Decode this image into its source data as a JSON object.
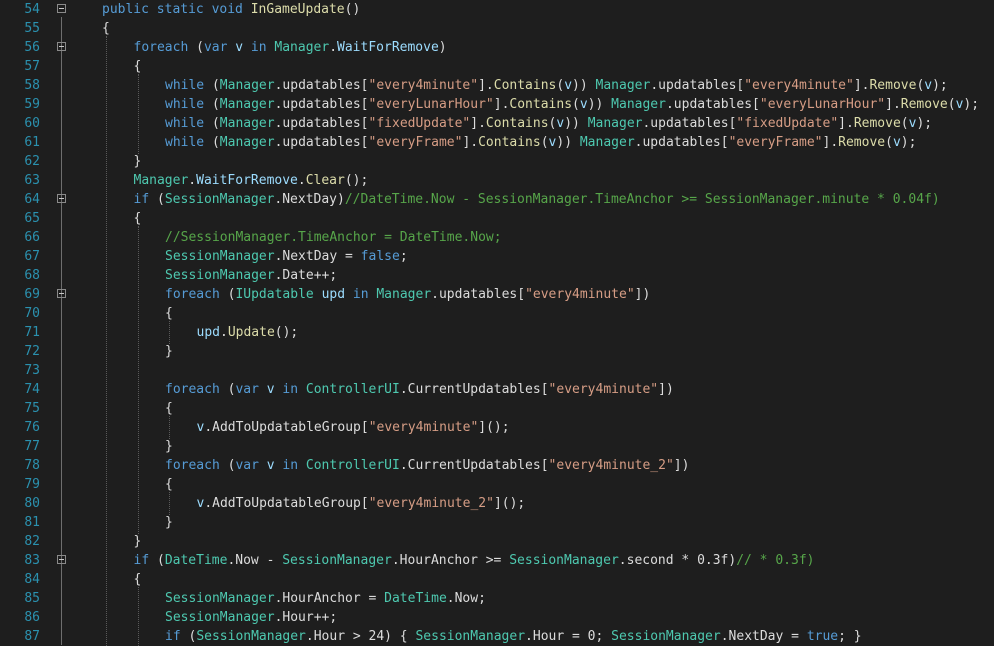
{
  "colors": {
    "background": "#1e1e1e",
    "line_number": "#2b91af",
    "keyword": "#569cd6",
    "type": "#4ec9b0",
    "method": "#dcdcaa",
    "string": "#d69d85",
    "comment": "#57a64a",
    "variable": "#9cdcfe",
    "plain": "#dcdcdc"
  },
  "fold_icon": "collapse-minus-icon",
  "lines": [
    {
      "n": "54",
      "indent": 0,
      "fold": true,
      "tokens": [
        [
          "kw",
          "public static void "
        ],
        [
          "mt",
          "InGameUpdate"
        ],
        [
          "pl",
          "()"
        ]
      ]
    },
    {
      "n": "55",
      "indent": 0,
      "fold": false,
      "tokens": [
        [
          "pl",
          "{"
        ]
      ]
    },
    {
      "n": "56",
      "indent": 1,
      "fold": true,
      "tokens": [
        [
          "kw",
          "foreach"
        ],
        [
          "pl",
          " ("
        ],
        [
          "kw",
          "var"
        ],
        [
          "pl",
          " "
        ],
        [
          "vr",
          "v"
        ],
        [
          "pl",
          " "
        ],
        [
          "kw",
          "in"
        ],
        [
          "pl",
          " "
        ],
        [
          "ty",
          "Manager"
        ],
        [
          "pl",
          "."
        ],
        [
          "vr",
          "WaitForRemove"
        ],
        [
          "pl",
          ")"
        ]
      ]
    },
    {
      "n": "57",
      "indent": 1,
      "fold": false,
      "tokens": [
        [
          "pl",
          "{"
        ]
      ]
    },
    {
      "n": "58",
      "indent": 2,
      "fold": false,
      "tokens": [
        [
          "kw",
          "while"
        ],
        [
          "pl",
          " ("
        ],
        [
          "ty",
          "Manager"
        ],
        [
          "pl",
          ".updatables["
        ],
        [
          "st",
          "\"every4minute\""
        ],
        [
          "pl",
          "]."
        ],
        [
          "mt",
          "Contains"
        ],
        [
          "pl",
          "("
        ],
        [
          "vr",
          "v"
        ],
        [
          "pl",
          ")) "
        ],
        [
          "ty",
          "Manager"
        ],
        [
          "pl",
          ".updatables["
        ],
        [
          "st",
          "\"every4minute\""
        ],
        [
          "pl",
          "]."
        ],
        [
          "mt",
          "Remove"
        ],
        [
          "pl",
          "("
        ],
        [
          "vr",
          "v"
        ],
        [
          "pl",
          ");"
        ]
      ]
    },
    {
      "n": "59",
      "indent": 2,
      "fold": false,
      "tokens": [
        [
          "kw",
          "while"
        ],
        [
          "pl",
          " ("
        ],
        [
          "ty",
          "Manager"
        ],
        [
          "pl",
          ".updatables["
        ],
        [
          "st",
          "\"everyLunarHour\""
        ],
        [
          "pl",
          "]."
        ],
        [
          "mt",
          "Contains"
        ],
        [
          "pl",
          "("
        ],
        [
          "vr",
          "v"
        ],
        [
          "pl",
          ")) "
        ],
        [
          "ty",
          "Manager"
        ],
        [
          "pl",
          ".updatables["
        ],
        [
          "st",
          "\"everyLunarHour\""
        ],
        [
          "pl",
          "]."
        ],
        [
          "mt",
          "Remove"
        ],
        [
          "pl",
          "("
        ],
        [
          "vr",
          "v"
        ],
        [
          "pl",
          ");"
        ]
      ]
    },
    {
      "n": "60",
      "indent": 2,
      "fold": false,
      "tokens": [
        [
          "kw",
          "while"
        ],
        [
          "pl",
          " ("
        ],
        [
          "ty",
          "Manager"
        ],
        [
          "pl",
          ".updatables["
        ],
        [
          "st",
          "\"fixedUpdate\""
        ],
        [
          "pl",
          "]."
        ],
        [
          "mt",
          "Contains"
        ],
        [
          "pl",
          "("
        ],
        [
          "vr",
          "v"
        ],
        [
          "pl",
          ")) "
        ],
        [
          "ty",
          "Manager"
        ],
        [
          "pl",
          ".updatables["
        ],
        [
          "st",
          "\"fixedUpdate\""
        ],
        [
          "pl",
          "]."
        ],
        [
          "mt",
          "Remove"
        ],
        [
          "pl",
          "("
        ],
        [
          "vr",
          "v"
        ],
        [
          "pl",
          ");"
        ]
      ]
    },
    {
      "n": "61",
      "indent": 2,
      "fold": false,
      "tokens": [
        [
          "kw",
          "while"
        ],
        [
          "pl",
          " ("
        ],
        [
          "ty",
          "Manager"
        ],
        [
          "pl",
          ".updatables["
        ],
        [
          "st",
          "\"everyFrame\""
        ],
        [
          "pl",
          "]."
        ],
        [
          "mt",
          "Contains"
        ],
        [
          "pl",
          "("
        ],
        [
          "vr",
          "v"
        ],
        [
          "pl",
          ")) "
        ],
        [
          "ty",
          "Manager"
        ],
        [
          "pl",
          ".updatables["
        ],
        [
          "st",
          "\"everyFrame\""
        ],
        [
          "pl",
          "]."
        ],
        [
          "mt",
          "Remove"
        ],
        [
          "pl",
          "("
        ],
        [
          "vr",
          "v"
        ],
        [
          "pl",
          ");"
        ]
      ]
    },
    {
      "n": "62",
      "indent": 1,
      "fold": false,
      "tokens": [
        [
          "pl",
          "}"
        ]
      ]
    },
    {
      "n": "63",
      "indent": 1,
      "fold": false,
      "tokens": [
        [
          "ty",
          "Manager"
        ],
        [
          "pl",
          "."
        ],
        [
          "vr",
          "WaitForRemove"
        ],
        [
          "pl",
          "."
        ],
        [
          "mt",
          "Clear"
        ],
        [
          "pl",
          "();"
        ]
      ]
    },
    {
      "n": "64",
      "indent": 1,
      "fold": true,
      "tokens": [
        [
          "kw",
          "if"
        ],
        [
          "pl",
          " ("
        ],
        [
          "ty",
          "SessionManager"
        ],
        [
          "pl",
          ".NextDay)"
        ],
        [
          "cm",
          "//DateTime.Now - SessionManager.TimeAnchor >= SessionManager.minute * 0.04f)"
        ]
      ]
    },
    {
      "n": "65",
      "indent": 1,
      "fold": false,
      "tokens": [
        [
          "pl",
          "{"
        ]
      ]
    },
    {
      "n": "66",
      "indent": 2,
      "fold": false,
      "tokens": [
        [
          "cm",
          "//SessionManager.TimeAnchor = DateTime.Now;"
        ]
      ]
    },
    {
      "n": "67",
      "indent": 2,
      "fold": false,
      "tokens": [
        [
          "ty",
          "SessionManager"
        ],
        [
          "pl",
          ".NextDay = "
        ],
        [
          "kw",
          "false"
        ],
        [
          "pl",
          ";"
        ]
      ]
    },
    {
      "n": "68",
      "indent": 2,
      "fold": false,
      "tokens": [
        [
          "ty",
          "SessionManager"
        ],
        [
          "pl",
          ".Date++;"
        ]
      ]
    },
    {
      "n": "69",
      "indent": 2,
      "fold": true,
      "tokens": [
        [
          "kw",
          "foreach"
        ],
        [
          "pl",
          " ("
        ],
        [
          "ty",
          "IUpdatable"
        ],
        [
          "pl",
          " "
        ],
        [
          "vr",
          "upd"
        ],
        [
          "pl",
          " "
        ],
        [
          "kw",
          "in"
        ],
        [
          "pl",
          " "
        ],
        [
          "ty",
          "Manager"
        ],
        [
          "pl",
          ".updatables["
        ],
        [
          "st",
          "\"every4minute\""
        ],
        [
          "pl",
          "])"
        ]
      ]
    },
    {
      "n": "70",
      "indent": 2,
      "fold": false,
      "tokens": [
        [
          "pl",
          "{"
        ]
      ]
    },
    {
      "n": "71",
      "indent": 3,
      "fold": false,
      "tokens": [
        [
          "vr",
          "upd"
        ],
        [
          "pl",
          "."
        ],
        [
          "mt",
          "Update"
        ],
        [
          "pl",
          "();"
        ]
      ]
    },
    {
      "n": "72",
      "indent": 2,
      "fold": false,
      "tokens": [
        [
          "pl",
          "}"
        ]
      ]
    },
    {
      "n": "73",
      "indent": 2,
      "fold": false,
      "tokens": []
    },
    {
      "n": "74",
      "indent": 2,
      "fold": false,
      "tokens": [
        [
          "kw",
          "foreach"
        ],
        [
          "pl",
          " ("
        ],
        [
          "kw",
          "var"
        ],
        [
          "pl",
          " "
        ],
        [
          "vr",
          "v"
        ],
        [
          "pl",
          " "
        ],
        [
          "kw",
          "in"
        ],
        [
          "pl",
          " "
        ],
        [
          "ty",
          "ControllerUI"
        ],
        [
          "pl",
          ".CurrentUpdatables["
        ],
        [
          "st",
          "\"every4minute\""
        ],
        [
          "pl",
          "])"
        ]
      ]
    },
    {
      "n": "75",
      "indent": 2,
      "fold": false,
      "tokens": [
        [
          "pl",
          "{"
        ]
      ]
    },
    {
      "n": "76",
      "indent": 3,
      "fold": false,
      "tokens": [
        [
          "vr",
          "v"
        ],
        [
          "pl",
          ".AddToUpdatableGroup["
        ],
        [
          "st",
          "\"every4minute\""
        ],
        [
          "pl",
          "]();"
        ]
      ]
    },
    {
      "n": "77",
      "indent": 2,
      "fold": false,
      "tokens": [
        [
          "pl",
          "}"
        ]
      ]
    },
    {
      "n": "78",
      "indent": 2,
      "fold": false,
      "tokens": [
        [
          "kw",
          "foreach"
        ],
        [
          "pl",
          " ("
        ],
        [
          "kw",
          "var"
        ],
        [
          "pl",
          " "
        ],
        [
          "vr",
          "v"
        ],
        [
          "pl",
          " "
        ],
        [
          "kw",
          "in"
        ],
        [
          "pl",
          " "
        ],
        [
          "ty",
          "ControllerUI"
        ],
        [
          "pl",
          ".CurrentUpdatables["
        ],
        [
          "st",
          "\"every4minute_2\""
        ],
        [
          "pl",
          "])"
        ]
      ]
    },
    {
      "n": "79",
      "indent": 2,
      "fold": false,
      "tokens": [
        [
          "pl",
          "{"
        ]
      ]
    },
    {
      "n": "80",
      "indent": 3,
      "fold": false,
      "tokens": [
        [
          "vr",
          "v"
        ],
        [
          "pl",
          ".AddToUpdatableGroup["
        ],
        [
          "st",
          "\"every4minute_2\""
        ],
        [
          "pl",
          "]();"
        ]
      ]
    },
    {
      "n": "81",
      "indent": 2,
      "fold": false,
      "tokens": [
        [
          "pl",
          "}"
        ]
      ]
    },
    {
      "n": "82",
      "indent": 1,
      "fold": false,
      "tokens": [
        [
          "pl",
          "}"
        ]
      ]
    },
    {
      "n": "83",
      "indent": 1,
      "fold": true,
      "tokens": [
        [
          "kw",
          "if"
        ],
        [
          "pl",
          " ("
        ],
        [
          "ty",
          "DateTime"
        ],
        [
          "pl",
          ".Now - "
        ],
        [
          "ty",
          "SessionManager"
        ],
        [
          "pl",
          ".HourAnchor >= "
        ],
        [
          "ty",
          "SessionManager"
        ],
        [
          "pl",
          ".second * 0.3f)"
        ],
        [
          "cm",
          "// * 0.3f)"
        ]
      ]
    },
    {
      "n": "84",
      "indent": 1,
      "fold": false,
      "tokens": [
        [
          "pl",
          "{"
        ]
      ]
    },
    {
      "n": "85",
      "indent": 2,
      "fold": false,
      "tokens": [
        [
          "ty",
          "SessionManager"
        ],
        [
          "pl",
          ".HourAnchor = "
        ],
        [
          "ty",
          "DateTime"
        ],
        [
          "pl",
          ".Now;"
        ]
      ]
    },
    {
      "n": "86",
      "indent": 2,
      "fold": false,
      "tokens": [
        [
          "ty",
          "SessionManager"
        ],
        [
          "pl",
          ".Hour++;"
        ]
      ]
    },
    {
      "n": "87",
      "indent": 2,
      "fold": false,
      "tokens": [
        [
          "kw",
          "if"
        ],
        [
          "pl",
          " ("
        ],
        [
          "ty",
          "SessionManager"
        ],
        [
          "pl",
          ".Hour > 24) { "
        ],
        [
          "ty",
          "SessionManager"
        ],
        [
          "pl",
          ".Hour = 0; "
        ],
        [
          "ty",
          "SessionManager"
        ],
        [
          "pl",
          ".NextDay = "
        ],
        [
          "kw",
          "true"
        ],
        [
          "pl",
          "; }"
        ]
      ]
    }
  ]
}
